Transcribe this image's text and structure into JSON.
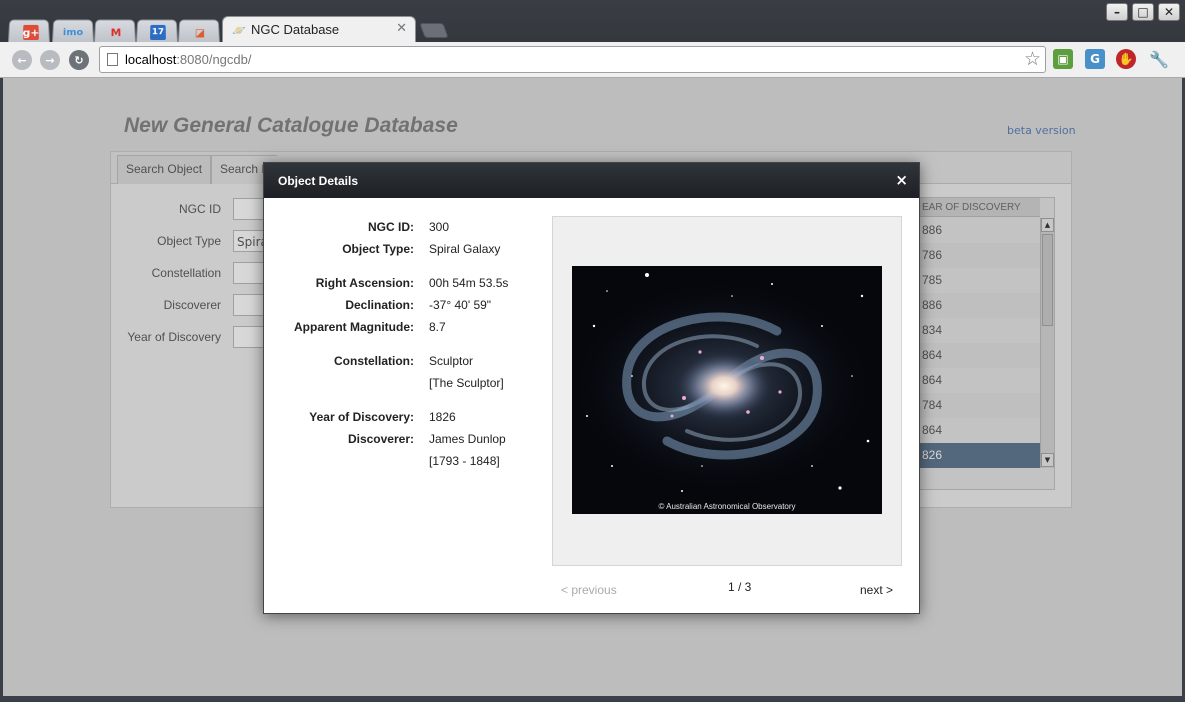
{
  "browser": {
    "tabs": [
      {
        "icon": "google-plus-icon",
        "glyph": "g+",
        "color": "#dd4b39"
      },
      {
        "icon": "imo-icon",
        "glyph": "imo",
        "color": "#3a8fd8"
      },
      {
        "icon": "gmail-icon",
        "glyph": "M",
        "color": "#d93025"
      },
      {
        "icon": "calendar-icon",
        "glyph": "17",
        "color": "#2b6cc4"
      },
      {
        "icon": "reader-icon",
        "glyph": "◪",
        "color": "#e05a2a"
      }
    ],
    "active_tab_title": "NGC Database",
    "url_host": "localhost",
    "url_rest": ":8080/ngcdb/"
  },
  "app": {
    "title": "New General Catalogue Database",
    "beta_label": "beta version",
    "tabs": [
      "Search Object",
      "Search B"
    ],
    "form": {
      "ngc_id_label": "NGC ID",
      "object_type_label": "Object Type",
      "object_type_value": "Spira",
      "constellation_label": "Constellation",
      "discoverer_label": "Discoverer",
      "year_label": "Year of Discovery"
    },
    "grid": {
      "header": "EAR OF DISCOVERY",
      "rows": [
        "886",
        "786",
        "785",
        "886",
        "834",
        "864",
        "864",
        "784",
        "864",
        "826"
      ],
      "selected_index": 9
    }
  },
  "modal": {
    "title": "Object Details",
    "close_glyph": "×",
    "details": {
      "ngc_id": {
        "label": "NGC ID:",
        "value": "300"
      },
      "object_type": {
        "label": "Object Type:",
        "value": "Spiral Galaxy"
      },
      "right_ascension": {
        "label": "Right Ascension:",
        "value": "00h 54m 53.5s"
      },
      "declination": {
        "label": "Declination:",
        "value": "-37° 40' 59\""
      },
      "magnitude": {
        "label": "Apparent Magnitude:",
        "value": "8.7"
      },
      "constellation": {
        "label": "Constellation:",
        "value": "Sculptor",
        "value2": "[The Sculptor]"
      },
      "year": {
        "label": "Year of Discovery:",
        "value": "1826"
      },
      "discoverer": {
        "label": "Discoverer:",
        "value": "James Dunlop",
        "value2": "[1793 - 1848]"
      }
    },
    "image_credit": "© Australian Astronomical Observatory",
    "pager": {
      "previous": "< previous",
      "count": "1 / 3",
      "next": "next >"
    }
  }
}
